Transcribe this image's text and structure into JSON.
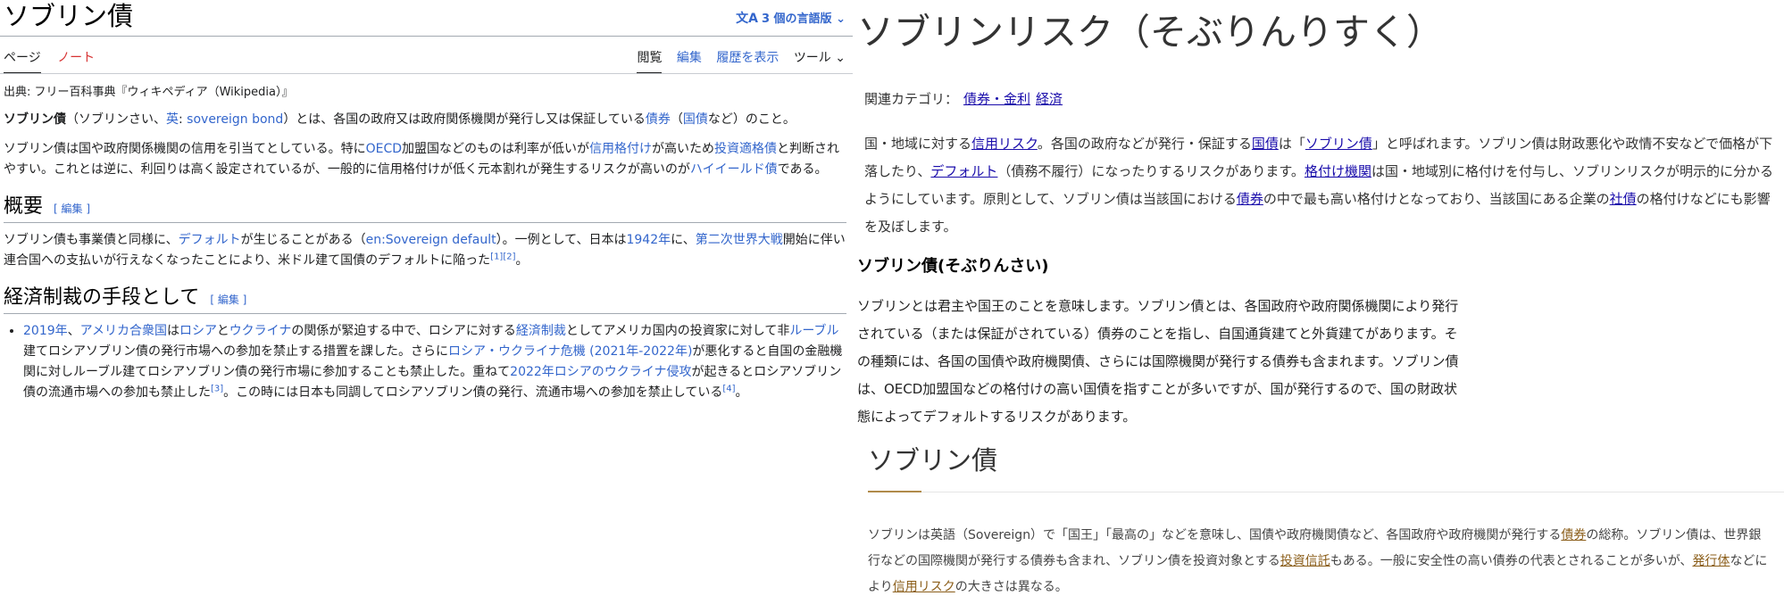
{
  "left": {
    "title": "ソブリン債",
    "lang_button": "3 個の言語版",
    "tabs_left": [
      "ページ",
      "ノート"
    ],
    "tabs_right": [
      "閲覧",
      "編集",
      "履歴を表示",
      "ツール"
    ],
    "source": "出典: フリー百科事典『ウィキペディア（Wikipedia）』",
    "intro1": {
      "bold": "ソブリン債",
      "t1": "（ソブリンさい、",
      "en_link": "英",
      "t2": ": ",
      "en_term": "sovereign bond",
      "t3": "）とは、各国の政府又は政府関係機関が発行し又は保証している",
      "link1": "債券",
      "t4": "（",
      "link2": "国債",
      "t5": "など）のこと。"
    },
    "intro2": {
      "t1": "ソブリン債は国や政府関係機関の信用を引当てとしている。特に",
      "link1": "OECD",
      "t2": "加盟国などのものは利率が低いが",
      "link2": "信用格付け",
      "t3": "が高いため",
      "link3": "投資適格債",
      "t4": "と判断されやすい。これとは逆に、利回りは高く設定されているが、一般的に信用格付けが低く元本割れが発生するリスクが高いのが",
      "link4": "ハイイールド債",
      "t5": "である。"
    },
    "edit_label": "[ 編集 ]",
    "sec1": {
      "heading": "概要",
      "t1": "ソブリン債も事業債と同様に、",
      "link1": "デフォルト",
      "t2": "が生じることがある（",
      "link2": "en:Sovereign default",
      "t3": "）。一例として、日本は",
      "link3": "1942年",
      "t4": "に、",
      "link4": "第二次世界大戦",
      "t5": "開始に伴い連合国への支払いが行えなくなったことにより、米ドル建て国債のデフォルトに陥った",
      "ref": "[1][2]",
      "t6": "。"
    },
    "sec2": {
      "heading": "経済制裁の手段として",
      "link1": "2019年",
      "t1": "、",
      "link2": "アメリカ合衆国",
      "t2": "は",
      "link3": "ロシア",
      "t3": "と",
      "link4": "ウクライナ",
      "t4": "の関係が緊迫する中で、ロシアに対する",
      "link5": "経済制裁",
      "t5": "としてアメリカ国内の投資家に対して非",
      "link6": "ルーブル",
      "t6": "建てロシアソブリン債の発行市場への参加を禁止する措置を課した。さらに",
      "link7": "ロシア・ウクライナ危機 (2021年-2022年)",
      "t7": "が悪化すると自国の金融機関に対しルーブル建てロシアソブリン債の発行市場に参加することも禁止した。重ねて",
      "link8": "2022年ロシアのウクライナ侵攻",
      "t8": "が起きるとロシアソブリン債の流通市場への参加も禁止した",
      "ref1": "[3]",
      "t9": "。この時には日本も同調してロシアソブリン債の発行、流通市場への参加を禁止している",
      "ref2": "[4]",
      "t10": "。"
    }
  },
  "right": {
    "title": "ソブリンリスク（そぶりんりすく）",
    "cat_label": "関連カテゴリ：",
    "cat_links": [
      "債券・金利",
      "経済"
    ],
    "p1": {
      "t1": "国・地域に対する",
      "link1": "信用リスク",
      "t2": "。各国の政府などが発行・保証する",
      "link2": "国債",
      "t3": "は「",
      "link3": "ソブリン債",
      "t4": "」と呼ばれます。ソブリン債は財政悪化や政情不安などで価格が下落したり、",
      "link4": "デフォルト",
      "t5": "（債務不履行）になったりするリスクがあります。",
      "link5": "格付け機関",
      "t6": "は国・地域別に格付けを付与し、ソブリンリスクが明示的に分かるようにしています。原則として、ソブリン債は当該国における",
      "link6": "債券",
      "t7": "の中で最も高い格付けとなっており、当該国にある企業の",
      "link7": "社債",
      "t8": "の格付けなどにも影響を及ぼします。"
    },
    "h3": "ソブリン債(そぶりんさい)",
    "p2": "ソブリンとは君主や国王のことを意味します。ソブリン債とは、各国政府や政府関係機関により発行されている（または保証がされている）債券のことを指し、自国通貨建てと外貨建てがあります。その種類には、各国の国債や政府機関債、さらには国際機関が発行する債券も含まれます。ソブリン債は、OECD加盟国などの格付けの高い国債を指すことが多いですが、国が発行するので、国の財政状態によってデフォルトするリスクがあります。",
    "h2": "ソブリン債",
    "p3": {
      "t1": "ソブリンは英語（Sovereign）で「国王」「最高の」などを意味し、国債や政府機関債など、各国政府や政府機関が発行する",
      "link1": "債券",
      "t2": "の総称。ソブリン債は、世界銀行などの国際機関が発行する債券も含まれ、ソブリン債を投資対象とする",
      "link2": "投資信託",
      "t3": "もある。一般に安全性の高い債券の代表とされることが多いが、",
      "link3": "発行体",
      "t4": "などにより",
      "link4": "信用リスク",
      "t5": "の大きさは異なる。"
    }
  }
}
